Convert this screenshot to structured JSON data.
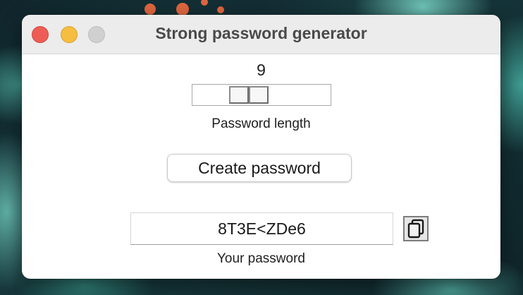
{
  "window": {
    "title": "Strong password generator"
  },
  "generator": {
    "length_value": "9",
    "length_label": "Password length",
    "create_button_label": "Create password",
    "password_value": "8T3E<ZDe6",
    "password_label": "Your password",
    "copy_icon": "copy-icon"
  },
  "colors": {
    "close": "#ee5d55",
    "minimize": "#f5be40",
    "zoom_disabled": "#d0d0d0"
  }
}
